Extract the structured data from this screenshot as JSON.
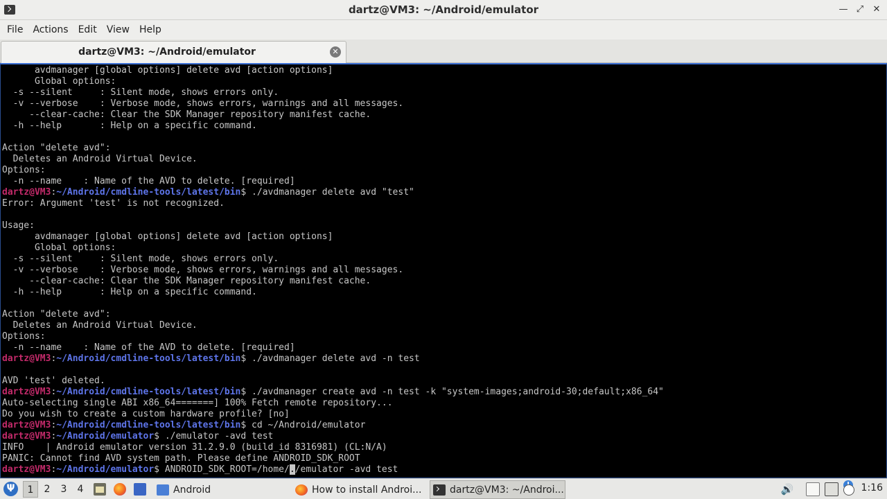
{
  "window": {
    "title": "dartz@VM3: ~/Android/emulator"
  },
  "menu": [
    "File",
    "Actions",
    "Edit",
    "View",
    "Help"
  ],
  "tab": {
    "label": "dartz@VM3: ~/Android/emulator"
  },
  "prompt": {
    "user": "dartz@VM3"
  },
  "terminal_lines": [
    {
      "text": "      avdmanager [global options] delete avd [action options]"
    },
    {
      "text": "      Global options:"
    },
    {
      "text": "  -s --silent     : Silent mode, shows errors only."
    },
    {
      "text": "  -v --verbose    : Verbose mode, shows errors, warnings and all messages."
    },
    {
      "text": "     --clear-cache: Clear the SDK Manager repository manifest cache."
    },
    {
      "text": "  -h --help       : Help on a specific command."
    },
    {
      "text": ""
    },
    {
      "text": "Action \"delete avd\":"
    },
    {
      "text": "  Deletes an Android Virtual Device."
    },
    {
      "text": "Options:"
    },
    {
      "text": "  -n --name    : Name of the AVD to delete. [required]"
    },
    {
      "prompt": true,
      "path": "~/Android/cmdline-tools/latest/bin",
      "cmd": "$ ./avdmanager delete avd \"test\""
    },
    {
      "text": "Error: Argument 'test' is not recognized."
    },
    {
      "text": ""
    },
    {
      "text": "Usage:"
    },
    {
      "text": "      avdmanager [global options] delete avd [action options]"
    },
    {
      "text": "      Global options:"
    },
    {
      "text": "  -s --silent     : Silent mode, shows errors only."
    },
    {
      "text": "  -v --verbose    : Verbose mode, shows errors, warnings and all messages."
    },
    {
      "text": "     --clear-cache: Clear the SDK Manager repository manifest cache."
    },
    {
      "text": "  -h --help       : Help on a specific command."
    },
    {
      "text": ""
    },
    {
      "text": "Action \"delete avd\":"
    },
    {
      "text": "  Deletes an Android Virtual Device."
    },
    {
      "text": "Options:"
    },
    {
      "text": "  -n --name    : Name of the AVD to delete. [required]"
    },
    {
      "prompt": true,
      "path": "~/Android/cmdline-tools/latest/bin",
      "cmd": "$ ./avdmanager delete avd -n test"
    },
    {
      "text": ""
    },
    {
      "text": "AVD 'test' deleted."
    },
    {
      "prompt": true,
      "path": "~/Android/cmdline-tools/latest/bin",
      "cmd": "$ ./avdmanager create avd -n test -k \"system-images;android-30;default;x86_64\""
    },
    {
      "text": "Auto-selecting single ABI x86_64=======] 100% Fetch remote repository..."
    },
    {
      "text": "Do you wish to create a custom hardware profile? [no]"
    },
    {
      "prompt": true,
      "path": "~/Android/cmdline-tools/latest/bin",
      "cmd": "$ cd ~/Android/emulator"
    },
    {
      "prompt": true,
      "path": "~/Android/emulator",
      "cmd": "$ ./emulator -avd test"
    },
    {
      "text": "INFO    | Android emulator version 31.2.9.0 (build_id 8316981) (CL:N/A)"
    },
    {
      "text": "PANIC: Cannot find AVD system path. Please define ANDROID_SDK_ROOT"
    },
    {
      "prompt": true,
      "path": "~/Android/emulator",
      "cmd": "$ ANDROID_SDK_ROOT=/home/",
      "cursor": ".",
      "after": "/emulator -avd test"
    }
  ],
  "taskbar": {
    "workspaces": [
      "1",
      "2",
      "3",
      "4"
    ],
    "active_workspace": "1",
    "tasks": [
      {
        "label": "Android",
        "icon": "folder-icon"
      },
      {
        "label": "How to install Androi...",
        "icon": "firefox-icon"
      },
      {
        "label": "dartz@VM3: ~/Androi...",
        "icon": "terminal-icon",
        "active": true
      }
    ],
    "clock": "1:16"
  }
}
